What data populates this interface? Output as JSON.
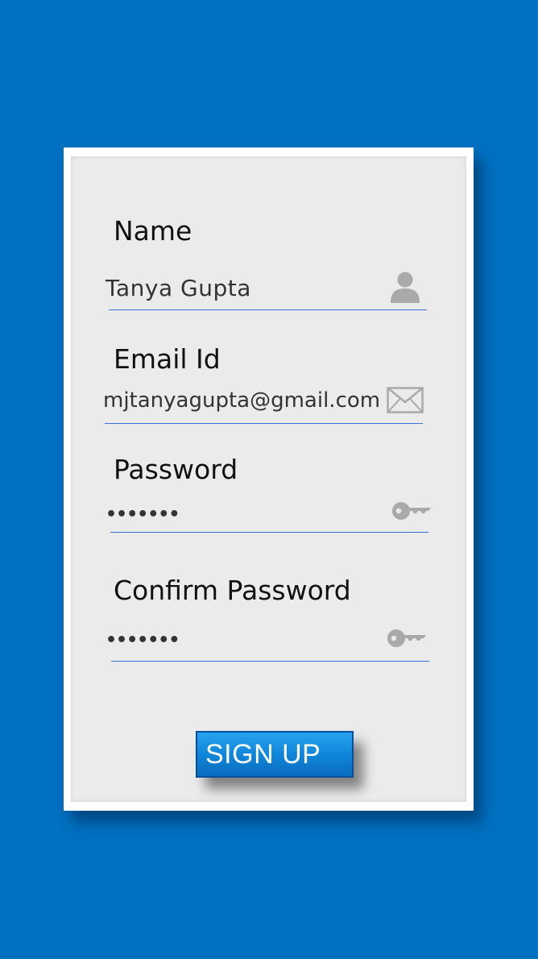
{
  "form": {
    "name": {
      "label": "Name",
      "value": "Tanya Gupta",
      "icon": "user-icon"
    },
    "email": {
      "label": "Email Id",
      "value": "mjtanyagupta@gmail.com",
      "icon": "envelope-icon"
    },
    "password": {
      "label": "Password",
      "value": "•••••••",
      "icon": "key-icon"
    },
    "confirm_password": {
      "label": "Confirm Password",
      "value": "•••••••",
      "icon": "key-icon"
    },
    "submit_label": "SIGN UP"
  },
  "colors": {
    "background": "#0070c0",
    "card": "#ecebeb",
    "underline": "#3b6fd8",
    "icon": "#a9a9a9",
    "button": "#1086da"
  }
}
